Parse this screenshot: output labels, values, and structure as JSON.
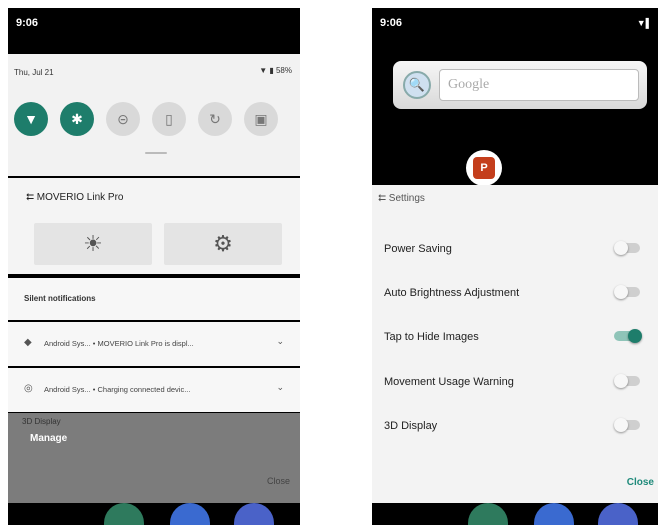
{
  "left": {
    "status_time": "9:06",
    "qs_date": "Thu, Jul 21",
    "qs_status": "▼ ▮ 58%",
    "tiles": [
      {
        "icon": "wifi-icon",
        "glyph": "▼",
        "state": "on"
      },
      {
        "icon": "bluetooth-icon",
        "glyph": "✱",
        "state": "on"
      },
      {
        "icon": "dnd-icon",
        "glyph": "⊝",
        "state": "off"
      },
      {
        "icon": "flashlight-icon",
        "glyph": "▯",
        "state": "off"
      },
      {
        "icon": "rotate-icon",
        "glyph": "↻",
        "state": "off"
      },
      {
        "icon": "battery-saver-icon",
        "glyph": "▣",
        "state": "off"
      }
    ],
    "moverio_title": "⮄ MOVERIO Link Pro",
    "brightness_glyph": "☀",
    "settings_glyph": "⚙",
    "silent_label": "Silent notifications",
    "notifications": [
      {
        "icon": "android-system-icon",
        "glyph": "◆",
        "text": "Android Sys... • MOVERIO Link Pro is displ...",
        "chevron": "⌄"
      },
      {
        "icon": "charging-icon",
        "glyph": "◎",
        "text": "Android Sys... • Charging connected devic...",
        "chevron": "⌄"
      }
    ],
    "behind_label": "3D Display",
    "manage": "Manage",
    "close": "Close"
  },
  "right": {
    "status_time": "9:06",
    "status_right": "▼▌",
    "google_placeholder": "Google",
    "ppt_letter": "P",
    "settings_title": "⮄ Settings",
    "settings": [
      {
        "label": "Power Saving",
        "on": false
      },
      {
        "label": "Auto Brightness Adjustment",
        "on": false
      },
      {
        "label": "Tap to Hide Images",
        "on": true
      },
      {
        "label": "Movement Usage Warning",
        "on": false
      },
      {
        "label": "3D Display",
        "on": false
      }
    ],
    "close": "Close"
  },
  "colors": {
    "accent": "#1e7d6b",
    "close_text": "#1e8a7a"
  }
}
